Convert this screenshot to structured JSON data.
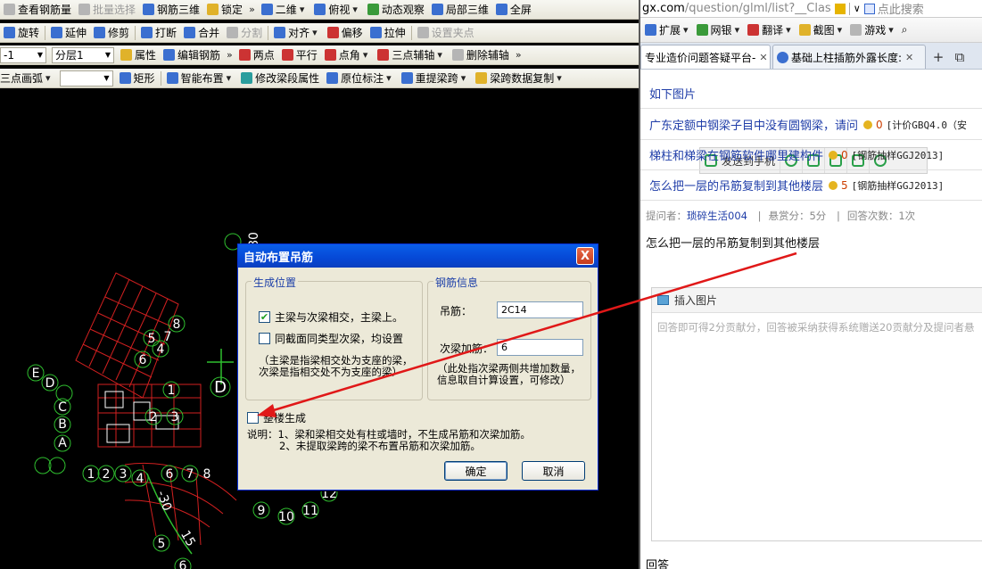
{
  "cad": {
    "toolbar1": {
      "view_rebar": "查看钢筋量",
      "batch_select": "批量选择",
      "rebar_3d": "钢筋三维",
      "lock": "锁定",
      "mode_2d": "二维",
      "top_view": "俯视",
      "dynamic_observe": "动态观察",
      "local_3d": "局部三维",
      "fullscreen": "全屏"
    },
    "toolbar2": {
      "rotate": "旋转",
      "extend": "延伸",
      "trim": "修剪",
      "break": "打断",
      "merge": "合并",
      "split": "分割",
      "align": "对齐",
      "offset": "偏移",
      "stretch": "拉伸",
      "set_node": "设置夹点"
    },
    "toolbar3": {
      "floor_num_value": "-1",
      "layer_value": "分层1",
      "properties": "属性",
      "edit_rebar": "编辑钢筋",
      "two_points": "两点",
      "parallel": "平行",
      "point_angle": "点角",
      "three_point_aux": "三点辅轴",
      "delete_aux": "删除辅轴"
    },
    "toolbar4": {
      "three_point_arc": "三点画弧",
      "rectangle": "矩形",
      "smart_layout": "智能布置",
      "modify_span_props": "修改梁段属性",
      "original_mark": "原位标注",
      "re_extract_span": "重提梁跨",
      "span_data_copy": "梁跨数据复制"
    },
    "canvas_labels": {
      "top_label": "80",
      "big_d": "D",
      "nums": [
        "1",
        "2",
        "3",
        "4",
        "5",
        "6",
        "7",
        "8"
      ],
      "nums_bottom": [
        "9",
        "10",
        "11",
        "12"
      ],
      "left_letters": [
        "A",
        "B",
        "C",
        "D",
        "E"
      ],
      "misc_5": "5",
      "misc_6": "6",
      "misc_15": "15",
      "misc_30": "-30"
    }
  },
  "dialog": {
    "title": "自动布置吊筋",
    "close_symbol": "X",
    "group_position": {
      "legend": "生成位置",
      "opt1_label": "主梁与次梁相交，主梁上。",
      "opt1_checked": true,
      "opt2_label": "同截面同类型次梁，均设置",
      "opt2_checked": false,
      "note_line1": "（主梁是指梁相交处为支座的梁，",
      "note_line2": "次梁是指相交处不为支座的梁）"
    },
    "group_rebar": {
      "legend": "钢筋信息",
      "hanger_label": "吊筋：",
      "hanger_value": "2C14",
      "secondary_label": "次梁加筋：",
      "secondary_value": "6",
      "note_line1": "（此处指次梁两侧共增加数量，",
      "note_line2": "信息取自计算设置，可修改）"
    },
    "whole_building_label": "整楼生成",
    "whole_building_checked": false,
    "desc_line1": "说明：1、梁和梁相交处有柱或墙时，不生成吊筋和次梁加筋。",
    "desc_line2": "2、未提取梁跨的梁不布置吊筋和次梁加筋。",
    "ok_label": "确定",
    "cancel_label": "取消"
  },
  "browser": {
    "address_main": "gx.com",
    "address_path": "/question/glml/list?__Clas",
    "search_placeholder": "点此搜索",
    "bar": {
      "extend": "扩展",
      "netbank": "网银",
      "translate": "翻译",
      "screenshot": "截图",
      "games": "游戏"
    },
    "tabs": [
      {
        "label": "专业造价问题答疑平台-",
        "active": true
      },
      {
        "label": "基础上柱插筋外露长度:",
        "active": false
      }
    ],
    "float_bar": {
      "send_to_phone": "发送到手机"
    },
    "first_link_partial": "如下图片",
    "questions": [
      {
        "title": "广东定额中钢梁子目中没有圆钢梁，请问",
        "score": "0",
        "tag": "[计价GBQ4.0（安"
      },
      {
        "title": "梯柱和梯梁在钢筋软件哪里建构件",
        "score": "0",
        "tag": "[钢筋抽样GGJ2013]"
      },
      {
        "title": "怎么把一层的吊筋复制到其他楼层",
        "score": "5",
        "tag": "[钢筋抽样GGJ2013]"
      }
    ],
    "meta": {
      "asker_label": "提问者：",
      "asker_name": "琐碎生活004",
      "reward": "悬赏分：5分",
      "answers": "回答次数：1次"
    },
    "question_text": "怎么把一层的吊筋复制到其他楼层",
    "editor": {
      "insert_image": "插入图片",
      "placeholder": "回答即可得2分贡献分，回答被采纳获得系统赠送20贡献分及提问者悬"
    },
    "answer_heading": "回答"
  },
  "colors": {
    "cad_bg": "#000000",
    "dialog_title": "#0a5fe8",
    "link": "#1f3da8",
    "annotation_arrow": "#e01818",
    "grid_red": "#d22020",
    "circle_green": "#2fbf2f"
  }
}
